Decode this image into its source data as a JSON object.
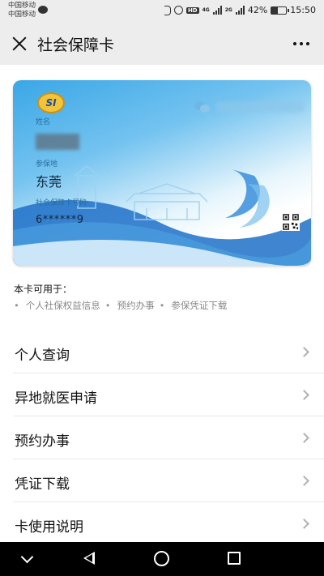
{
  "status_bar": {
    "carrier1": "中国移动",
    "carrier2": "中国移动",
    "net_label_1": "4G",
    "net_label_2": "2G",
    "battery_percent": "42%",
    "battery_level": 0.42,
    "time": "15:50",
    "hd_label": "HD"
  },
  "nav": {
    "title": "社会保障卡"
  },
  "card": {
    "logo_text": "SI",
    "name_label": "姓名",
    "insured_label": "参保地",
    "insured_city": "东莞",
    "card_number_label": "社会保障卡号码",
    "card_number": "6******9"
  },
  "usage": {
    "title": "本卡可用于：",
    "items": [
      "个人社保权益信息",
      "预约办事",
      "参保凭证下载"
    ]
  },
  "menu": {
    "items": [
      {
        "label": "个人查询"
      },
      {
        "label": "异地就医申请"
      },
      {
        "label": "预约办事"
      },
      {
        "label": "凭证下载"
      },
      {
        "label": "卡使用说明"
      }
    ]
  },
  "colors": {
    "card_blue": "#3aa7e6",
    "nav_bg": "#ededed",
    "text_muted": "#888888"
  }
}
